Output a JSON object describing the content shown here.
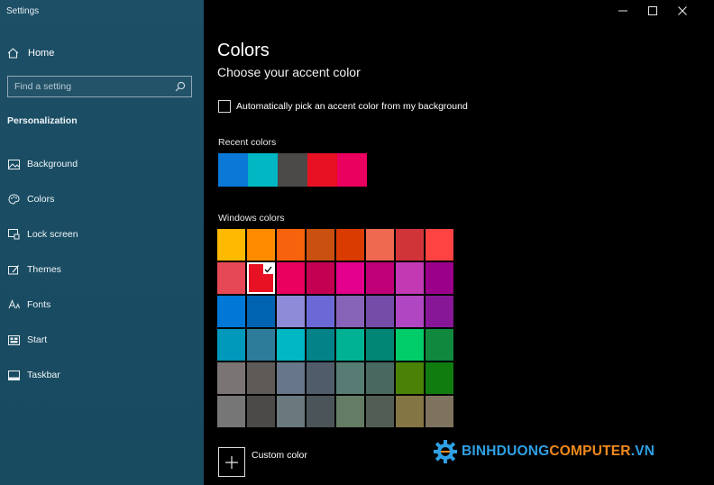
{
  "window": {
    "title": "Settings"
  },
  "sidebar": {
    "home_label": "Home",
    "search_placeholder": "Find a setting",
    "section_label": "Personalization",
    "items": [
      {
        "label": "Background",
        "icon": "picture-icon"
      },
      {
        "label": "Colors",
        "icon": "palette-icon"
      },
      {
        "label": "Lock screen",
        "icon": "lock-screen-icon"
      },
      {
        "label": "Themes",
        "icon": "themes-icon"
      },
      {
        "label": "Fonts",
        "icon": "fonts-icon"
      },
      {
        "label": "Start",
        "icon": "start-icon"
      },
      {
        "label": "Taskbar",
        "icon": "taskbar-icon"
      }
    ]
  },
  "main": {
    "title": "Colors",
    "subtitle": "Choose your accent color",
    "auto_pick_label": "Automatically pick an accent color from my background",
    "auto_pick_checked": false,
    "recent_label": "Recent colors",
    "recent_colors": [
      "#0a78d7",
      "#00b7c3",
      "#4c4a48",
      "#e81123",
      "#ea005e"
    ],
    "windows_label": "Windows colors",
    "windows_colors": [
      [
        "#ffb900",
        "#ff8c00",
        "#f7630c",
        "#ca5010",
        "#da3b01",
        "#ef6950",
        "#d13438",
        "#ff4343"
      ],
      [
        "#e74856",
        "#e81123",
        "#ea005e",
        "#c30052",
        "#e3008c",
        "#bf0077",
        "#c239b3",
        "#9a0089"
      ],
      [
        "#0078d7",
        "#0063b1",
        "#8e8cd8",
        "#6b69d6",
        "#8764b8",
        "#744da9",
        "#b146c2",
        "#881798"
      ],
      [
        "#0099bc",
        "#2d7d9a",
        "#00b7c3",
        "#038387",
        "#00b294",
        "#018574",
        "#00cc6a",
        "#10893e"
      ],
      [
        "#7a7574",
        "#5d5a58",
        "#68768a",
        "#515c6b",
        "#567c73",
        "#486860",
        "#498205",
        "#107c10"
      ],
      [
        "#767676",
        "#4c4a48",
        "#69797e",
        "#4a5459",
        "#647c64",
        "#525e54",
        "#847545",
        "#7e735f"
      ]
    ],
    "selected_color": {
      "row": 1,
      "col": 1
    },
    "custom_color_label": "Custom color"
  },
  "watermark": {
    "part1": "BINHDUONG",
    "part2": "COMPUTER",
    "part3": ".VN"
  }
}
